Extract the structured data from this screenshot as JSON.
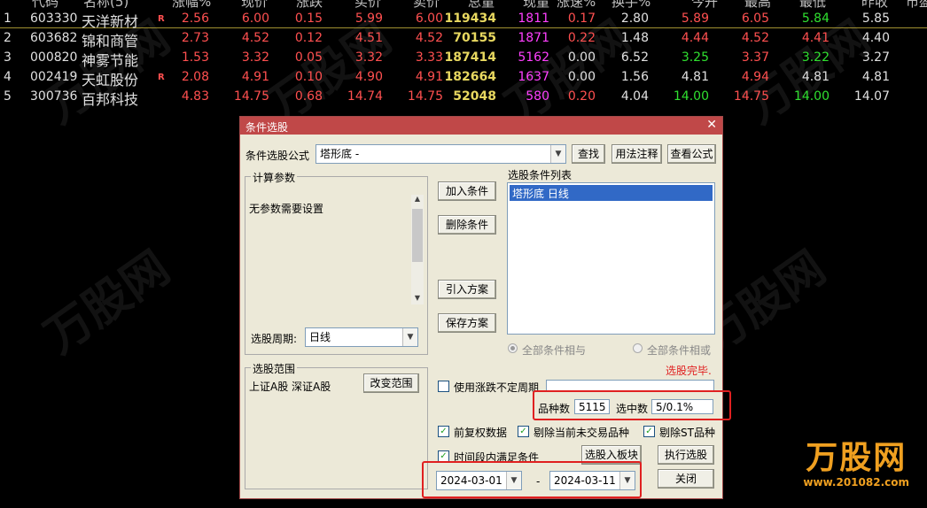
{
  "header": {
    "cols": [
      "代码",
      "名称(5)",
      "涨幅%",
      "现价",
      "涨跌",
      "买价",
      "卖价",
      "总量",
      "现量",
      "涨速%",
      "换手%",
      "今开",
      "最高",
      "最低",
      "昨收",
      "市盈"
    ]
  },
  "rows": [
    {
      "idx": "1",
      "code": "603330",
      "name": "天洋新材",
      "flag": "R",
      "chg": "2.56",
      "price": "6.00",
      "diff": "0.15",
      "buy": "5.99",
      "sell": "6.00",
      "vol": "119434",
      "cur": "1811",
      "spd": "0.17",
      "turn": "2.80",
      "open": "5.89",
      "high": "6.05",
      "low": "5.84",
      "prev": "5.85"
    },
    {
      "idx": "2",
      "code": "603682",
      "name": "锦和商管",
      "flag": "",
      "chg": "2.73",
      "price": "4.52",
      "diff": "0.12",
      "buy": "4.51",
      "sell": "4.52",
      "vol": "70155",
      "cur": "1871",
      "spd": "0.22",
      "turn": "1.48",
      "open": "4.44",
      "high": "4.52",
      "low": "4.41",
      "prev": "4.40"
    },
    {
      "idx": "3",
      "code": "000820",
      "name": "神雾节能",
      "flag": "",
      "chg": "1.53",
      "price": "3.32",
      "diff": "0.05",
      "buy": "3.32",
      "sell": "3.33",
      "vol": "187414",
      "cur": "5162",
      "spd": "0.00",
      "turn": "6.52",
      "open": "3.25",
      "high": "3.37",
      "low": "3.22",
      "prev": "3.27"
    },
    {
      "idx": "4",
      "code": "002419",
      "name": "天虹股份",
      "flag": "R",
      "chg": "2.08",
      "price": "4.91",
      "diff": "0.10",
      "buy": "4.90",
      "sell": "4.91",
      "vol": "182664",
      "cur": "1637",
      "spd": "0.00",
      "turn": "1.56",
      "open": "4.81",
      "high": "4.94",
      "low": "4.81",
      "prev": "4.81"
    },
    {
      "idx": "5",
      "code": "300736",
      "name": "百邦科技",
      "flag": "",
      "chg": "4.83",
      "price": "14.75",
      "diff": "0.68",
      "buy": "14.74",
      "sell": "14.75",
      "vol": "52048",
      "cur": "580",
      "spd": "0.20",
      "turn": "4.04",
      "open": "14.00",
      "high": "14.75",
      "low": "14.00",
      "prev": "14.07"
    }
  ],
  "dialog": {
    "title": "条件选股",
    "close": "✕",
    "formula_label": "条件选股公式",
    "formula_value": "塔形底  -",
    "btn_find": "查找",
    "btn_usage": "用法注释",
    "btn_view": "查看公式",
    "params_title": "计算参数",
    "params_text": "无参数需要设置",
    "period_label": "选股周期:",
    "period_value": "日线",
    "list_title": "选股条件列表",
    "list_item": "塔形底  日线",
    "btn_add": "加入条件",
    "btn_del": "删除条件",
    "btn_import": "引入方案",
    "btn_save": "保存方案",
    "radio_and": "全部条件相与",
    "radio_or": "全部条件相或",
    "status": "选股完毕.",
    "range_title": "选股范围",
    "range_text": "上证A股 深证A股",
    "btn_range": "改变范围",
    "use_period": "使用涨跌不定周期",
    "count_label": "品种数",
    "count_value": "5115",
    "sel_label": "选中数",
    "sel_value": "5/0.1%",
    "chk_fq": "前复权数据",
    "chk_notrade": "剔除当前未交易品种",
    "chk_st": "剔除ST品种",
    "chk_time": "时间段内满足条件",
    "btn_toblock": "选股入板块",
    "btn_exec": "执行选股",
    "date_from": "2024-03-01",
    "date_sep": "-",
    "date_to": "2024-03-11",
    "btn_close": "关闭"
  },
  "logo": {
    "text": "万股网",
    "url": "www.201082.com"
  },
  "watermark": "万股网"
}
